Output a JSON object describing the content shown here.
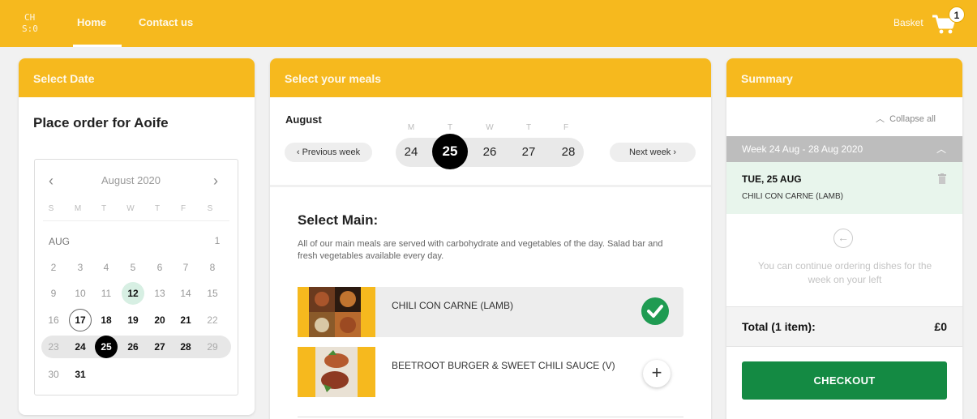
{
  "topbar": {
    "logo_text": "CH\nS:0",
    "nav": {
      "home": "Home",
      "contact": "Contact us"
    },
    "basket_label": "Basket",
    "basket_count": "1",
    "color": "#f6b91e"
  },
  "date_panel": {
    "title": "Select Date",
    "place_order": "Place order for Aoife",
    "calendar": {
      "month_label": "August 2020",
      "prev": "‹",
      "next": "›",
      "dow": [
        "S",
        "M",
        "T",
        "W",
        "T",
        "F",
        "S"
      ],
      "month_short": "AUG",
      "days": {
        "d1": "1",
        "d2": "2",
        "d3": "3",
        "d4": "4",
        "d5": "5",
        "d6": "6",
        "d7": "7",
        "d8": "8",
        "d9": "9",
        "d10": "10",
        "d11": "11",
        "d12": "12",
        "d13": "13",
        "d14": "14",
        "d15": "15",
        "d16": "16",
        "d17": "17",
        "d18": "18",
        "d19": "19",
        "d20": "20",
        "d21": "21",
        "d22": "22",
        "d23": "23",
        "d24": "24",
        "d25": "25",
        "d26": "26",
        "d27": "27",
        "d28": "28",
        "d29": "29",
        "d30": "30",
        "d31": "31"
      }
    }
  },
  "meals_panel": {
    "title": "Select your meals",
    "month": "August",
    "prev_week": "‹  Previous week",
    "next_week": "Next week  ›",
    "week_dow": [
      "M",
      "T",
      "W",
      "T",
      "F"
    ],
    "week_days": [
      "24",
      "25",
      "26",
      "27",
      "28"
    ],
    "selected_day": "25",
    "select_main": "Select Main:",
    "main_desc": "All of our main meals are served with carbohydrate and vegetables of the day. Salad bar and fresh vegetables available every day.",
    "meals": [
      {
        "name": "CHILI CON CARNE (LAMB)",
        "selected": true
      },
      {
        "name": "BEETROOT BURGER & SWEET CHILI SAUCE (V)",
        "selected": false,
        "add": "+"
      }
    ]
  },
  "summary_panel": {
    "title": "Summary",
    "collapse_all": "Collapse all",
    "week_header": "Week 24 Aug - 28 Aug 2020",
    "item_day": "TUE, 25 AUG",
    "item_dish": "CHILI CON CARNE (LAMB)",
    "info": "You can continue ordering dishes for the week on your left",
    "total_label": "Total (1 item):",
    "total_value": "£0",
    "checkout": "CHECKOUT",
    "checkout_color": "#148a43"
  }
}
